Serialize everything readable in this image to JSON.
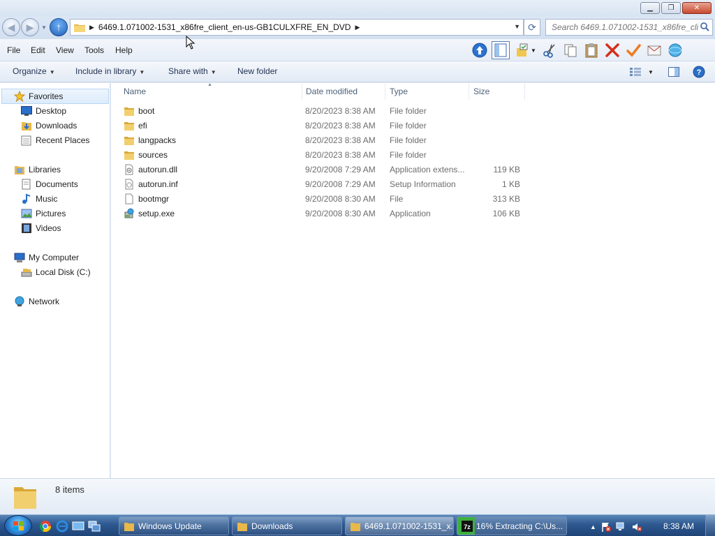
{
  "window": {
    "minimize": "▁",
    "maximize": "❐",
    "close": "✕"
  },
  "address": {
    "path": "6469.1.071002-1531_x86fre_client_en-us-GB1CULXFRE_EN_DVD",
    "search_placeholder": "Search 6469.1.071002-1531_x86fre_clie..."
  },
  "menu": {
    "file": "File",
    "edit": "Edit",
    "view": "View",
    "tools": "Tools",
    "help": "Help"
  },
  "toolbar": {
    "organize": "Organize",
    "include_in_library": "Include in library",
    "share_with": "Share with",
    "new_folder": "New folder"
  },
  "nav": {
    "favorites": "Favorites",
    "desktop": "Desktop",
    "downloads": "Downloads",
    "recent_places": "Recent Places",
    "libraries": "Libraries",
    "documents": "Documents",
    "music": "Music",
    "pictures": "Pictures",
    "videos": "Videos",
    "my_computer": "My Computer",
    "local_disk": "Local Disk (C:)",
    "network": "Network"
  },
  "columns": {
    "name": "Name",
    "date": "Date modified",
    "type": "Type",
    "size": "Size"
  },
  "files": [
    {
      "name": "boot",
      "date": "8/20/2023 8:38 AM",
      "type": "File folder",
      "size": "",
      "icon": "folder-icon"
    },
    {
      "name": "efi",
      "date": "8/20/2023 8:38 AM",
      "type": "File folder",
      "size": "",
      "icon": "folder-icon"
    },
    {
      "name": "langpacks",
      "date": "8/20/2023 8:38 AM",
      "type": "File folder",
      "size": "",
      "icon": "folder-icon"
    },
    {
      "name": "sources",
      "date": "8/20/2023 8:38 AM",
      "type": "File folder",
      "size": "",
      "icon": "folder-icon"
    },
    {
      "name": "autorun.dll",
      "date": "9/20/2008 7:29 AM",
      "type": "Application extens...",
      "size": "119 KB",
      "icon": "dll-icon"
    },
    {
      "name": "autorun.inf",
      "date": "9/20/2008 7:29 AM",
      "type": "Setup Information",
      "size": "1 KB",
      "icon": "inf-icon"
    },
    {
      "name": "bootmgr",
      "date": "9/20/2008 8:30 AM",
      "type": "File",
      "size": "313 KB",
      "icon": "file-icon"
    },
    {
      "name": "setup.exe",
      "date": "9/20/2008 8:30 AM",
      "type": "Application",
      "size": "106 KB",
      "icon": "setup-icon"
    }
  ],
  "details": {
    "count": "8 items"
  },
  "taskbar": {
    "tasks": [
      {
        "label": "Windows Update"
      },
      {
        "label": "Downloads"
      },
      {
        "label": "6469.1.071002-1531_x..."
      },
      {
        "label": "16% Extracting C:\\Us..."
      }
    ],
    "extract_progress": 0.16,
    "clock": "8:38 AM"
  },
  "colors": {
    "accent": "#2d5890",
    "selection": "#dcebfb",
    "progress": "#3fb040"
  }
}
